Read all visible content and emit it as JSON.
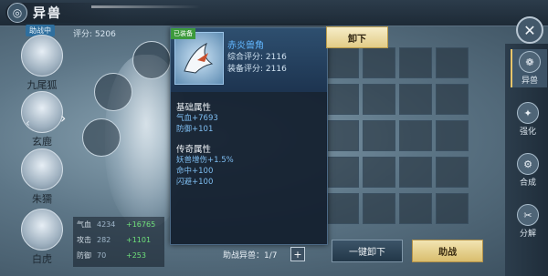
{
  "header": {
    "title": "异兽",
    "logo_glyph": "◎"
  },
  "left": {
    "badge": "助战中",
    "score_label": "评分: 5206",
    "beasts": [
      {
        "name": "九尾狐"
      },
      {
        "name": "玄鹿"
      },
      {
        "name": "朱獳"
      },
      {
        "name": "白虎"
      }
    ],
    "arrow": "›",
    "arrow2": "‹"
  },
  "stats": [
    {
      "label": "气血",
      "base": "4234",
      "add": "+16765"
    },
    {
      "label": "攻击",
      "base": "282",
      "add": "+1101"
    },
    {
      "label": "防御",
      "base": "70",
      "add": "+253"
    }
  ],
  "tooltip": {
    "equipped_tag": "已装备",
    "item_name": "赤炎兽角",
    "composite_score": "综合评分: 2116",
    "equip_score": "装备评分: 2116",
    "base_title": "基础属性",
    "base_attrs": [
      "气血+7693",
      "防御+101"
    ],
    "legend_title": "传奇属性",
    "legend_attrs": [
      "妖兽增伤+1.5%",
      "命中+100",
      "闪避+100"
    ]
  },
  "buttons": {
    "unload": "卸下",
    "unload_all": "一键卸下",
    "assist": "助战",
    "close": "✕",
    "plus": "+"
  },
  "assist_count": "助战异兽：1/7",
  "sidebar": {
    "items": [
      {
        "label": "异兽",
        "icon": "paw-icon",
        "glyph": "❁",
        "active": true
      },
      {
        "label": "强化",
        "icon": "enhance-icon",
        "glyph": "✦",
        "active": false
      },
      {
        "label": "合成",
        "icon": "combine-icon",
        "glyph": "⚙",
        "active": false
      },
      {
        "label": "分解",
        "icon": "decompose-icon",
        "glyph": "✂",
        "active": false
      }
    ]
  },
  "colors": {
    "accent_gold": "#e2cc86",
    "item_name": "#62b7ff",
    "stat_add": "#6fe07a"
  }
}
